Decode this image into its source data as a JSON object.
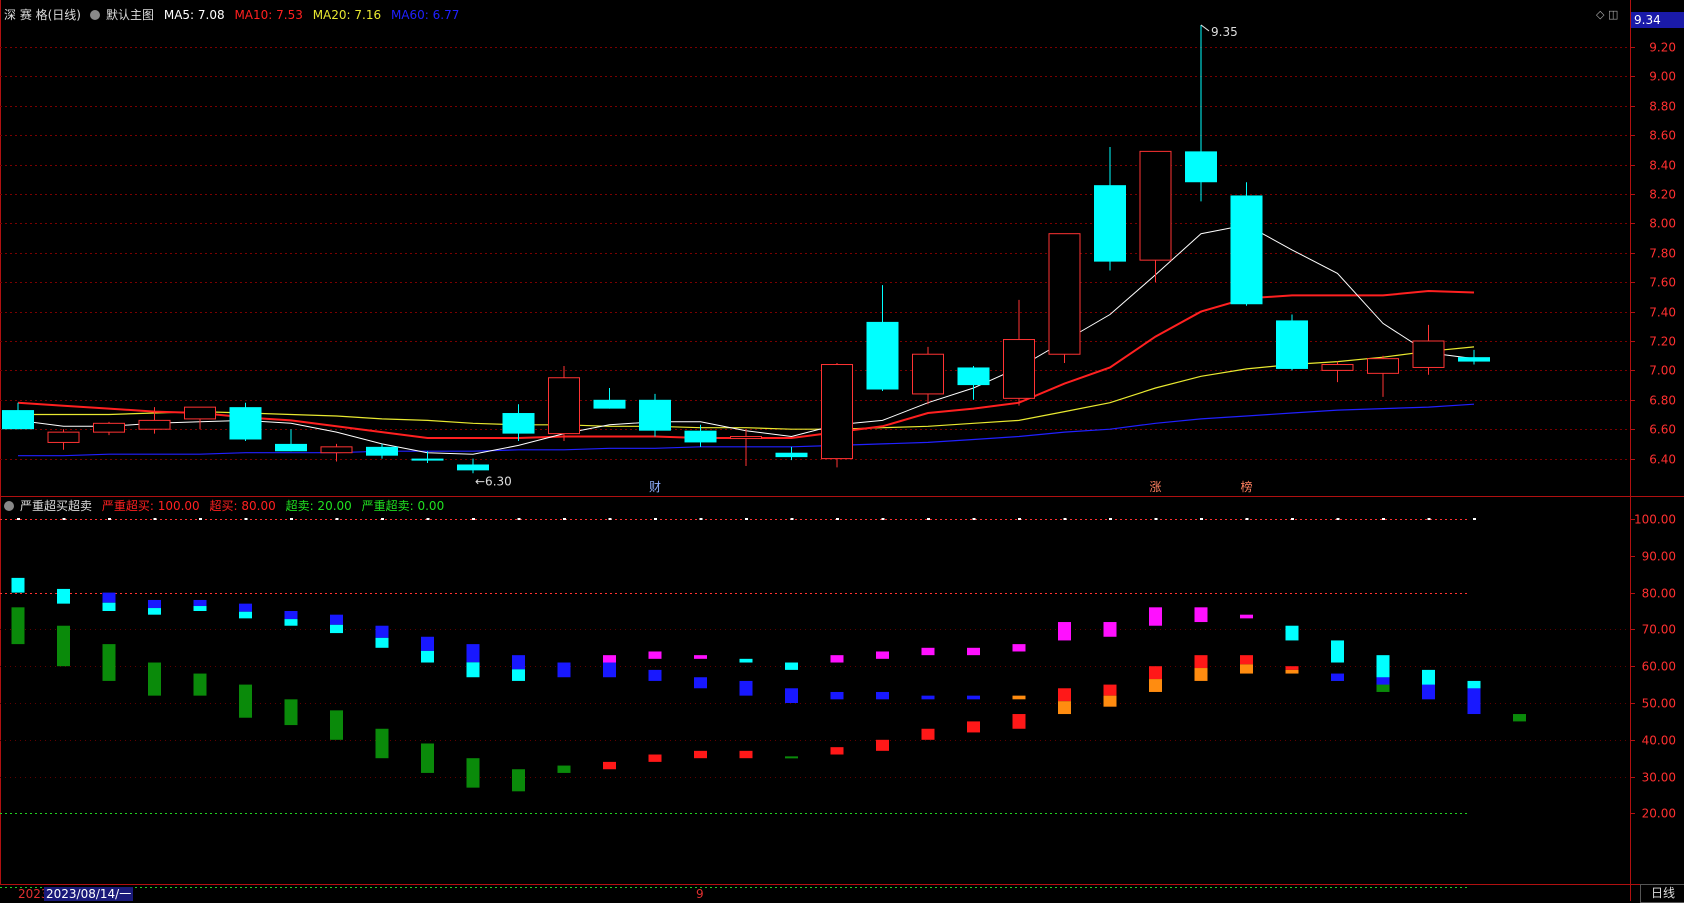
{
  "main_header": {
    "stock_name": "深 赛 格(日线)",
    "template": "默认主图",
    "ma5": "MA5: 7.08",
    "ma10": "MA10: 7.53",
    "ma20": "MA20: 7.16",
    "ma60": "MA60: 6.77"
  },
  "indicator_header": {
    "name": "严重超买超卖",
    "severe_overbought": "严重超买: 100.00",
    "overbought": "超买: 80.00",
    "oversold": "超卖: 20.00",
    "severe_oversold": "严重超卖: 0.00"
  },
  "last_price": "9.34",
  "top_icons": "◇ ◫",
  "date_cursor": "2023/08/14/一",
  "year_label": "2023",
  "month_label": "9",
  "period_button": "日线",
  "colors": {
    "up": "#ff3333",
    "down": "#00ffff",
    "ma5": "#ffffff",
    "ma10": "#ff2020",
    "ma20": "#e8e830",
    "ma60": "#2020ff",
    "axis_text": "#ff3030"
  },
  "chart_data": [
    {
      "type": "candlestick",
      "y_ticks": [
        "9.20",
        "9.00",
        "8.80",
        "8.60",
        "8.40",
        "8.20",
        "8.00",
        "7.80",
        "7.60",
        "7.40",
        "7.20",
        "7.00",
        "6.80",
        "6.60",
        "6.40"
      ],
      "ylim": [
        6.3,
        9.4
      ],
      "high_annotation": "9.35",
      "low_annotation": "6.30",
      "event_markers": [
        {
          "index": 14,
          "text": "财"
        },
        {
          "index": 25,
          "text": "涨"
        },
        {
          "index": 27,
          "text": "榜"
        }
      ],
      "candles": [
        {
          "o": 6.73,
          "h": 6.78,
          "l": 6.6,
          "c": 6.6
        },
        {
          "o": 6.51,
          "h": 6.6,
          "l": 6.46,
          "c": 6.58
        },
        {
          "o": 6.58,
          "h": 6.65,
          "l": 6.56,
          "c": 6.64
        },
        {
          "o": 6.6,
          "h": 6.75,
          "l": 6.57,
          "c": 6.66
        },
        {
          "o": 6.67,
          "h": 6.75,
          "l": 6.6,
          "c": 6.75
        },
        {
          "o": 6.75,
          "h": 6.78,
          "l": 6.52,
          "c": 6.53
        },
        {
          "o": 6.5,
          "h": 6.6,
          "l": 6.45,
          "c": 6.45
        },
        {
          "o": 6.44,
          "h": 6.5,
          "l": 6.38,
          "c": 6.48
        },
        {
          "o": 6.48,
          "h": 6.5,
          "l": 6.4,
          "c": 6.42
        },
        {
          "o": 6.4,
          "h": 6.45,
          "l": 6.37,
          "c": 6.39
        },
        {
          "o": 6.36,
          "h": 6.4,
          "l": 6.3,
          "c": 6.32
        },
        {
          "o": 6.71,
          "h": 6.77,
          "l": 6.52,
          "c": 6.57
        },
        {
          "o": 6.57,
          "h": 7.03,
          "l": 6.52,
          "c": 6.95
        },
        {
          "o": 6.8,
          "h": 6.88,
          "l": 6.74,
          "c": 6.74
        },
        {
          "o": 6.8,
          "h": 6.84,
          "l": 6.55,
          "c": 6.59
        },
        {
          "o": 6.59,
          "h": 6.63,
          "l": 6.48,
          "c": 6.51
        },
        {
          "o": 6.55,
          "h": 6.6,
          "l": 6.35,
          "c": 6.55
        },
        {
          "o": 6.44,
          "h": 6.48,
          "l": 6.39,
          "c": 6.41
        },
        {
          "o": 6.4,
          "h": 7.05,
          "l": 6.34,
          "c": 7.04
        },
        {
          "o": 7.33,
          "h": 7.58,
          "l": 6.86,
          "c": 6.87
        },
        {
          "o": 6.84,
          "h": 7.16,
          "l": 6.77,
          "c": 7.11
        },
        {
          "o": 7.02,
          "h": 7.03,
          "l": 6.8,
          "c": 6.9
        },
        {
          "o": 6.81,
          "h": 7.48,
          "l": 6.76,
          "c": 7.21
        },
        {
          "o": 7.11,
          "h": 7.93,
          "l": 7.05,
          "c": 7.93
        },
        {
          "o": 8.26,
          "h": 8.52,
          "l": 7.68,
          "c": 7.74
        },
        {
          "o": 7.75,
          "h": 8.49,
          "l": 7.6,
          "c": 8.49
        },
        {
          "o": 8.49,
          "h": 9.35,
          "l": 8.15,
          "c": 8.28
        },
        {
          "o": 8.19,
          "h": 8.28,
          "l": 7.44,
          "c": 7.45
        },
        {
          "o": 7.34,
          "h": 7.38,
          "l": 7.0,
          "c": 7.01
        },
        {
          "o": 7.0,
          "h": 7.06,
          "l": 6.92,
          "c": 7.04
        },
        {
          "o": 6.98,
          "h": 7.1,
          "l": 6.82,
          "c": 7.08
        },
        {
          "o": 7.02,
          "h": 7.31,
          "l": 6.97,
          "c": 7.2
        },
        {
          "o": 7.09,
          "h": 7.14,
          "l": 7.04,
          "c": 7.06
        }
      ],
      "ma5": [
        6.66,
        6.62,
        6.62,
        6.64,
        6.65,
        6.66,
        6.64,
        6.58,
        6.5,
        6.44,
        6.43,
        6.49,
        6.57,
        6.63,
        6.65,
        6.65,
        6.59,
        6.55,
        6.63,
        6.66,
        6.78,
        6.88,
        7.02,
        7.2,
        7.38,
        7.65,
        7.93,
        7.99,
        7.82,
        7.66,
        7.32,
        7.12,
        7.08
      ],
      "ma10": [
        6.78,
        6.76,
        6.74,
        6.72,
        6.71,
        6.68,
        6.66,
        6.62,
        6.58,
        6.54,
        6.54,
        6.54,
        6.55,
        6.55,
        6.55,
        6.54,
        6.54,
        6.54,
        6.58,
        6.62,
        6.71,
        6.74,
        6.78,
        6.91,
        7.02,
        7.23,
        7.4,
        7.49,
        7.51,
        7.51,
        7.51,
        7.54,
        7.53
      ],
      "ma20": [
        6.7,
        6.7,
        6.7,
        6.71,
        6.72,
        6.71,
        6.7,
        6.69,
        6.67,
        6.66,
        6.64,
        6.63,
        6.63,
        6.62,
        6.62,
        6.61,
        6.61,
        6.6,
        6.6,
        6.61,
        6.62,
        6.64,
        6.66,
        6.72,
        6.78,
        6.88,
        6.96,
        7.01,
        7.04,
        7.06,
        7.09,
        7.13,
        7.16
      ],
      "ma60": [
        6.42,
        6.42,
        6.43,
        6.43,
        6.43,
        6.44,
        6.44,
        6.44,
        6.45,
        6.45,
        6.45,
        6.46,
        6.46,
        6.47,
        6.47,
        6.48,
        6.48,
        6.48,
        6.49,
        6.5,
        6.51,
        6.53,
        6.55,
        6.58,
        6.6,
        6.64,
        6.67,
        6.69,
        6.71,
        6.73,
        6.74,
        6.75,
        6.77
      ]
    },
    {
      "type": "bar",
      "y_ticks": [
        "100.00",
        "90.00",
        "80.00",
        "70.00",
        "60.00",
        "50.00",
        "40.00",
        "30.00",
        "20.00"
      ],
      "ylim": [
        0,
        105
      ],
      "levels": [
        100,
        80,
        20,
        0
      ],
      "green_bars": [
        [
          66,
          76
        ],
        [
          60,
          71
        ],
        [
          56,
          66
        ],
        [
          52,
          61
        ],
        [
          52,
          58
        ],
        [
          46,
          55
        ],
        [
          44,
          51
        ],
        [
          40,
          48
        ],
        [
          35,
          43
        ],
        [
          31,
          39
        ],
        [
          27,
          35
        ],
        [
          26,
          32
        ],
        [
          31,
          33
        ],
        null,
        null,
        null,
        null,
        [
          35,
          35.5
        ],
        null,
        null,
        null,
        null,
        null,
        null,
        null,
        null,
        null,
        null,
        null,
        [
          56,
          57
        ],
        [
          53,
          56
        ],
        null,
        [
          48,
          51
        ],
        [
          45,
          47
        ]
      ],
      "upper_blocks": [
        {
          "v": [
            80,
            84
          ],
          "c": "down"
        },
        {
          "v": [
            77,
            81
          ],
          "c": "down"
        },
        {
          "v": [
            75,
            80
          ],
          "c": "mix"
        },
        {
          "v": [
            74,
            78
          ],
          "c": "mix"
        },
        {
          "v": [
            75,
            78
          ],
          "c": "mix"
        },
        {
          "v": [
            73,
            77
          ],
          "c": "mix"
        },
        {
          "v": [
            71,
            75
          ],
          "c": "mix"
        },
        {
          "v": [
            69,
            74
          ],
          "c": "mix"
        },
        {
          "v": [
            65,
            71
          ],
          "c": "mix"
        },
        {
          "v": [
            61,
            68
          ],
          "c": "mix"
        },
        {
          "v": [
            57,
            66
          ],
          "c": "mix"
        },
        {
          "v": [
            56,
            63
          ],
          "c": "mix"
        },
        {
          "v": [
            57,
            61
          ],
          "c": "blue"
        },
        {
          "v": [
            57,
            61
          ],
          "c": "blue"
        },
        {
          "v": [
            56,
            59
          ],
          "c": "blue"
        },
        {
          "v": [
            54,
            57
          ],
          "c": "blue"
        },
        {
          "v": [
            52,
            56
          ],
          "c": "blue"
        },
        {
          "v": [
            50,
            54
          ],
          "c": "blue"
        },
        {
          "v": [
            51,
            53
          ],
          "c": "blue"
        },
        {
          "v": [
            51,
            53
          ],
          "c": "blue"
        },
        {
          "v": [
            51,
            52
          ],
          "c": "blue"
        },
        {
          "v": [
            51,
            52
          ],
          "c": "blue"
        },
        {
          "v": [
            51,
            52
          ],
          "c": "orange"
        },
        {
          "v": [
            47,
            54
          ],
          "c": "redorange"
        },
        {
          "v": [
            49,
            55
          ],
          "c": "redorange"
        },
        {
          "v": [
            53,
            60
          ],
          "c": "redorange"
        },
        {
          "v": [
            56,
            63
          ],
          "c": "redorange"
        },
        {
          "v": [
            58,
            63
          ],
          "c": "redorange"
        },
        {
          "v": [
            58,
            60
          ],
          "c": "redorange"
        },
        {
          "v": [
            56,
            58
          ],
          "c": "blue"
        },
        {
          "v": [
            55,
            59
          ],
          "c": "blue"
        },
        {
          "v": [
            51,
            57
          ],
          "c": "blue"
        },
        {
          "v": [
            47,
            55
          ],
          "c": "blue"
        }
      ],
      "lower_blocks": [
        null,
        null,
        null,
        null,
        null,
        null,
        null,
        null,
        null,
        null,
        null,
        null,
        null,
        {
          "v": [
            32,
            34
          ],
          "c": "up"
        },
        {
          "v": [
            34,
            36
          ],
          "c": "up"
        },
        {
          "v": [
            35,
            37
          ],
          "c": "up"
        },
        {
          "v": [
            35,
            37
          ],
          "c": "up"
        },
        null,
        {
          "v": [
            36,
            38
          ],
          "c": "up"
        },
        {
          "v": [
            37,
            40
          ],
          "c": "up"
        },
        {
          "v": [
            40,
            43
          ],
          "c": "up"
        },
        {
          "v": [
            42,
            45
          ],
          "c": "up"
        },
        {
          "v": [
            43,
            47
          ],
          "c": "up"
        },
        null,
        null,
        null,
        null,
        null,
        null,
        null,
        null,
        null,
        null
      ],
      "top_blocks": [
        null,
        null,
        null,
        null,
        null,
        null,
        null,
        null,
        null,
        null,
        null,
        null,
        null,
        {
          "v": [
            61,
            63
          ],
          "c": "magenta"
        },
        {
          "v": [
            62,
            64
          ],
          "c": "magenta"
        },
        {
          "v": [
            62,
            63
          ],
          "c": "magenta"
        },
        {
          "v": [
            61,
            62
          ],
          "c": "down"
        },
        {
          "v": [
            59,
            61
          ],
          "c": "down"
        },
        {
          "v": [
            61,
            63
          ],
          "c": "magenta"
        },
        {
          "v": [
            62,
            64
          ],
          "c": "magenta"
        },
        {
          "v": [
            63,
            65
          ],
          "c": "magenta"
        },
        {
          "v": [
            63,
            65
          ],
          "c": "magenta"
        },
        {
          "v": [
            64,
            66
          ],
          "c": "magenta"
        },
        {
          "v": [
            67,
            72
          ],
          "c": "magenta"
        },
        {
          "v": [
            68,
            72
          ],
          "c": "magenta"
        },
        {
          "v": [
            71,
            76
          ],
          "c": "magenta"
        },
        {
          "v": [
            72,
            76
          ],
          "c": "magenta"
        },
        {
          "v": [
            73,
            74
          ],
          "c": "magenta"
        },
        {
          "v": [
            67,
            71
          ],
          "c": "down"
        },
        {
          "v": [
            61,
            67
          ],
          "c": "down"
        },
        {
          "v": [
            57,
            63
          ],
          "c": "down"
        },
        {
          "v": [
            55,
            59
          ],
          "c": "down"
        },
        {
          "v": [
            54,
            56
          ],
          "c": "down"
        }
      ]
    }
  ]
}
